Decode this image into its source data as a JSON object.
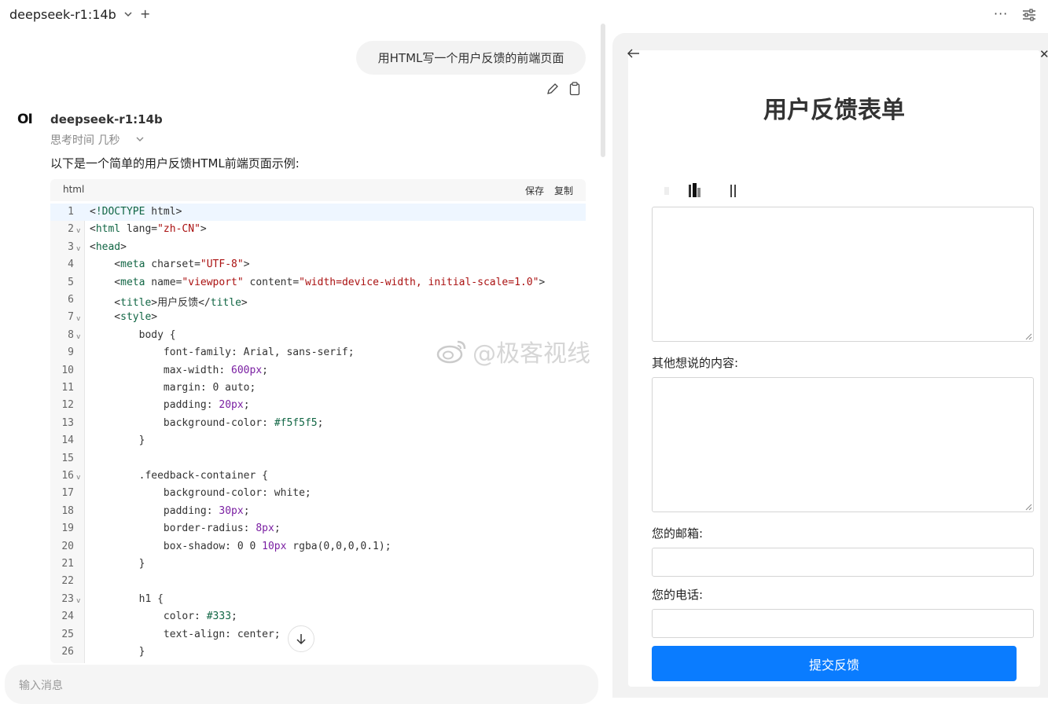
{
  "header": {
    "model_name": "deepseek-r1:14b"
  },
  "chat": {
    "user_message": "用HTML写一个用户反馈的前端页面",
    "assistant_avatar": "OI",
    "assistant_name": "deepseek-r1:14b",
    "thinking_label": "思考时间 几秒",
    "intro": "以下是一个简单的用户反馈HTML前端页面示例:"
  },
  "code_block": {
    "language": "html",
    "save_label": "保存",
    "copy_label": "复制",
    "lines": [
      {
        "n": "1",
        "fold": false,
        "text": "<!DOCTYPE html>"
      },
      {
        "n": "2",
        "fold": true,
        "text": "<html lang=\"zh-CN\">"
      },
      {
        "n": "3",
        "fold": true,
        "text": "<head>"
      },
      {
        "n": "4",
        "fold": false,
        "text": "    <meta charset=\"UTF-8\">"
      },
      {
        "n": "5",
        "fold": false,
        "text": "    <meta name=\"viewport\" content=\"width=device-width, initial-scale=1.0\">"
      },
      {
        "n": "6",
        "fold": false,
        "text": "    <title>用户反馈</title>"
      },
      {
        "n": "7",
        "fold": true,
        "text": "    <style>"
      },
      {
        "n": "8",
        "fold": true,
        "text": "        body {"
      },
      {
        "n": "9",
        "fold": false,
        "text": "            font-family: Arial, sans-serif;"
      },
      {
        "n": "10",
        "fold": false,
        "text": "            max-width: 600px;"
      },
      {
        "n": "11",
        "fold": false,
        "text": "            margin: 0 auto;"
      },
      {
        "n": "12",
        "fold": false,
        "text": "            padding: 20px;"
      },
      {
        "n": "13",
        "fold": false,
        "text": "            background-color: #f5f5f5;"
      },
      {
        "n": "14",
        "fold": false,
        "text": "        }"
      },
      {
        "n": "15",
        "fold": false,
        "text": ""
      },
      {
        "n": "16",
        "fold": true,
        "text": "        .feedback-container {"
      },
      {
        "n": "17",
        "fold": false,
        "text": "            background-color: white;"
      },
      {
        "n": "18",
        "fold": false,
        "text": "            padding: 30px;"
      },
      {
        "n": "19",
        "fold": false,
        "text": "            border-radius: 8px;"
      },
      {
        "n": "20",
        "fold": false,
        "text": "            box-shadow: 0 0 10px rgba(0,0,0,0.1);"
      },
      {
        "n": "21",
        "fold": false,
        "text": "        }"
      },
      {
        "n": "22",
        "fold": false,
        "text": ""
      },
      {
        "n": "23",
        "fold": true,
        "text": "        h1 {"
      },
      {
        "n": "24",
        "fold": false,
        "text": "            color: #333;"
      },
      {
        "n": "25",
        "fold": false,
        "text": "            text-align: center;"
      },
      {
        "n": "26",
        "fold": false,
        "text": "        }"
      }
    ]
  },
  "input": {
    "placeholder": "输入消息"
  },
  "watermark": {
    "text": "@极客视线"
  },
  "preview": {
    "form_title": "用户反馈表单",
    "other_label": "其他想说的内容:",
    "email_label": "您的邮箱:",
    "phone_label": "您的电话:",
    "submit_label": "提交反馈"
  },
  "colors": {
    "accent": "#0a7cff",
    "code_tag": "#116644",
    "code_string": "#aa1111",
    "code_number": "#7a1fa2"
  },
  "icons": [
    "chevron-down-icon",
    "plus-icon",
    "more-icon",
    "settings-sliders-icon",
    "edit-pencil-icon",
    "clipboard-icon",
    "arrow-down-icon",
    "arrow-left-icon",
    "close-icon"
  ]
}
